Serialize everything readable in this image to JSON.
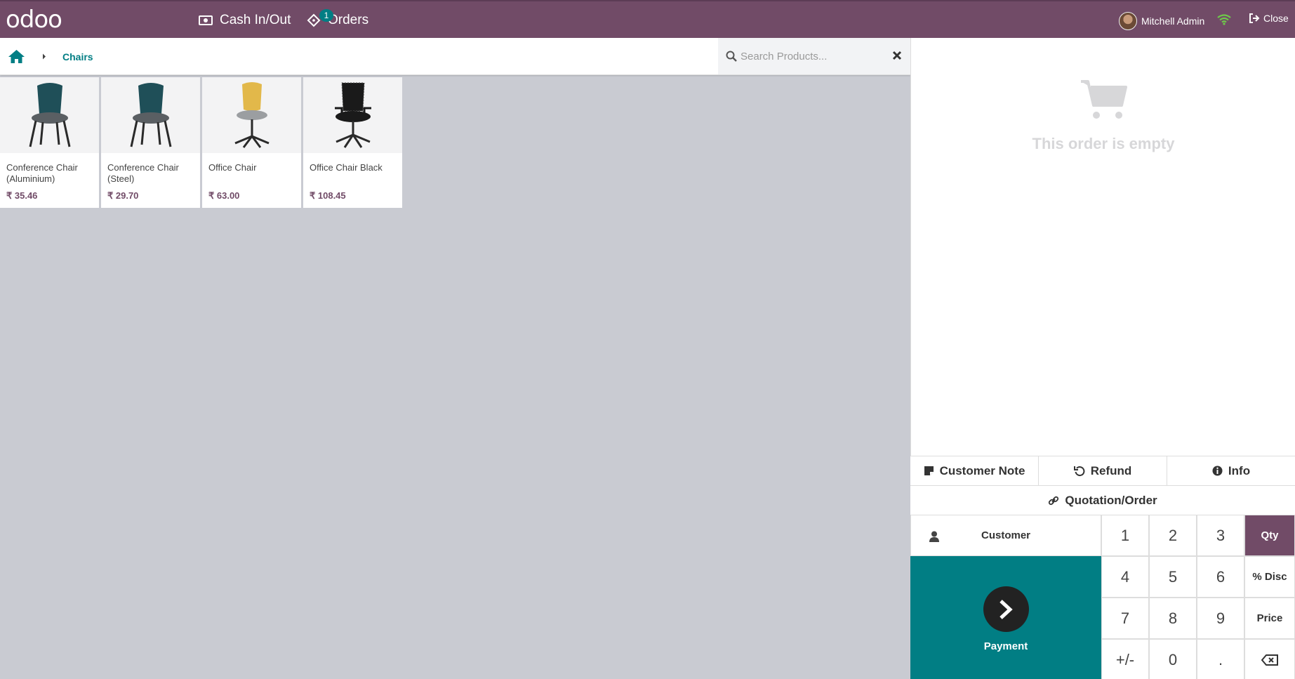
{
  "header": {
    "logo_text": "odoo",
    "cash_label": "Cash In/Out",
    "orders_label": "Orders",
    "orders_badge": "1",
    "user_name": "Mitchell Admin",
    "close_label": "Close"
  },
  "breadcrumb": {
    "current": "Chairs"
  },
  "search": {
    "placeholder": "Search Products..."
  },
  "products": [
    {
      "name": "Conference Chair (Aluminium)",
      "price": "₹ 35.46",
      "color": "#1f4f58"
    },
    {
      "name": "Conference Chair (Steel)",
      "price": "₹ 29.70",
      "color": "#1f4f58"
    },
    {
      "name": "Office Chair",
      "price": "₹ 63.00",
      "color": "#e2b84a"
    },
    {
      "name": "Office Chair Black",
      "price": "₹ 108.45",
      "color": "#1a1a1a"
    }
  ],
  "order": {
    "empty_text": "This order is empty"
  },
  "controls": {
    "customer_note": "Customer Note",
    "refund": "Refund",
    "info": "Info",
    "quotation": "Quotation/Order",
    "customer": "Customer",
    "payment": "Payment"
  },
  "numpad": {
    "k1": "1",
    "k2": "2",
    "k3": "3",
    "qty": "Qty",
    "k4": "4",
    "k5": "5",
    "k6": "6",
    "disc": "% Disc",
    "k7": "7",
    "k8": "8",
    "k9": "9",
    "price": "Price",
    "sign": "+/-",
    "k0": "0",
    "dot": "."
  },
  "colors": {
    "brand": "#714b67",
    "accent": "#017e84"
  }
}
